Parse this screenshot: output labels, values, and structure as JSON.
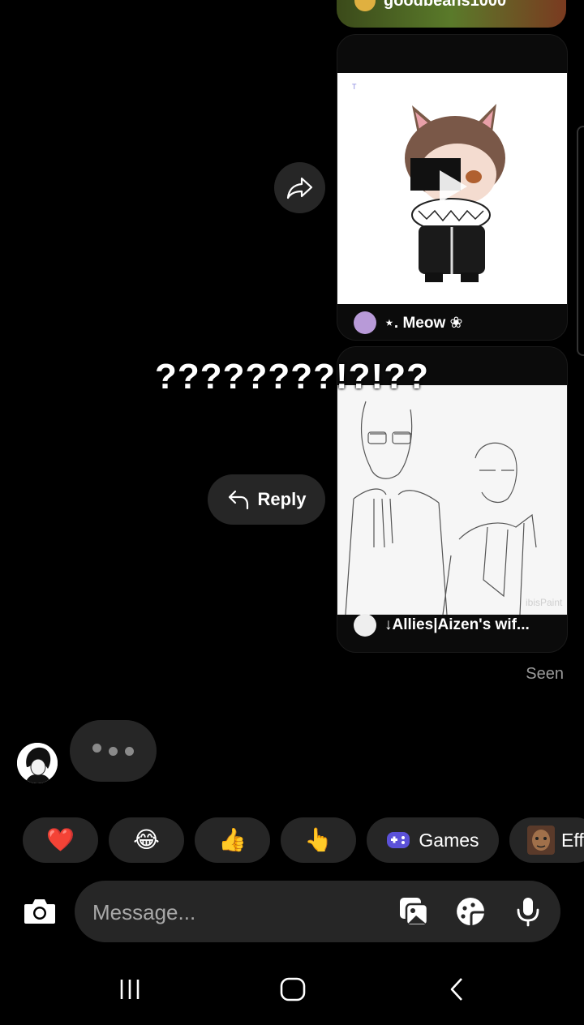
{
  "top_card": {
    "username": "goodbeans1000"
  },
  "reels": [
    {
      "username": "⋆. Meow ❀"
    },
    {
      "username": "↓Allies|Aizen's wif..."
    }
  ],
  "overlay_text": "????????!?!??",
  "reply_label": "Reply",
  "seen_label": "Seen",
  "reactions": [
    {
      "emoji": "❤️",
      "icon": "heart-emoji"
    },
    {
      "emoji": "😂",
      "icon": "laughing-emoji"
    },
    {
      "emoji": "👍",
      "icon": "thumbs-up-emoji"
    },
    {
      "emoji": "👆",
      "icon": "pointing-up-emoji"
    }
  ],
  "games_label": "Games",
  "effects_label": "Eff",
  "composer": {
    "placeholder": "Message..."
  },
  "colors": {
    "background": "#000000",
    "bubble": "#262626",
    "seen": "#9a9a9a",
    "games_icon": "#5b51d8"
  }
}
